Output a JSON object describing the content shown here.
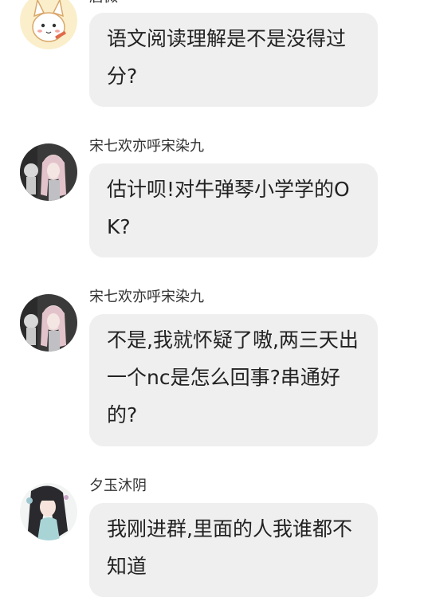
{
  "messages": [
    {
      "sender": "唐微",
      "text": "语文阅读理解是不是没得过分?",
      "avatar": "cartoon-fox-avatar-icon"
    },
    {
      "sender": "宋七欢亦呼宋染九",
      "text": "估计呗!对牛弹琴小学学的OK?",
      "avatar": "girl-photo-avatar-icon"
    },
    {
      "sender": "宋七欢亦呼宋染九",
      "text": "不是,我就怀疑了嗷,两三天出一个nc是怎么回事?串通好的?",
      "avatar": "girl-photo-avatar-icon"
    },
    {
      "sender": "夕玉沐阴",
      "text": "我刚进群,里面的人我谁都不知道",
      "avatar": "anime-girl-avatar-icon"
    }
  ],
  "colors": {
    "background": "#ffffff",
    "bubble": "#efefef",
    "text": "#222222",
    "sender": "#333333"
  }
}
